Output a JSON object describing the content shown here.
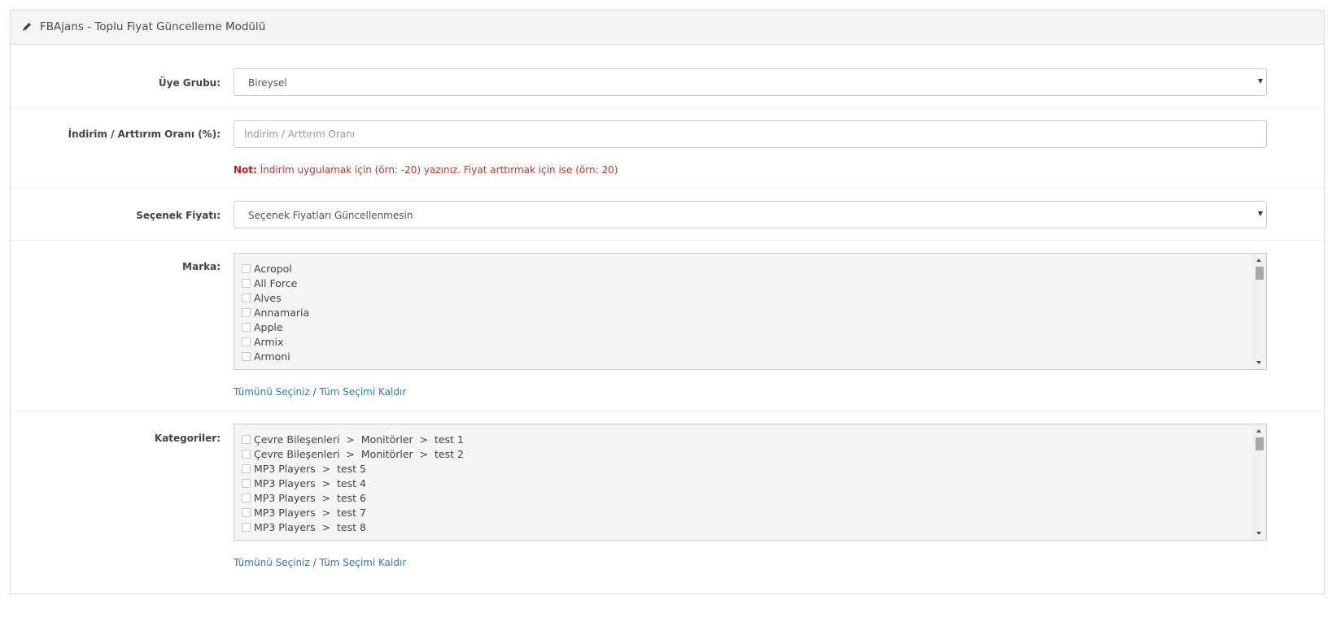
{
  "header": {
    "title": "FBAjans - Toplu Fiyat Güncelleme Modülü",
    "icon": "pencil-icon"
  },
  "form": {
    "member_group": {
      "label": "Üye Grubu:",
      "selected": "Bireysel"
    },
    "rate": {
      "label": "İndirim / Arttırım Oranı (%):",
      "placeholder": "İndirim / Arttırım Oranı",
      "value": "",
      "note_prefix": "Not:",
      "note_text": " İndirim uygulamak için (örn: -20) yazınız. Fiyat arttırmak için ise (örn: 20)"
    },
    "option_price": {
      "label": "Seçenek Fiyatı:",
      "selected": "Seçenek Fiyatları Güncellenmesin"
    },
    "brand": {
      "label": "Marka:",
      "items": [
        "Acropol",
        "All Force",
        "Alves",
        "Annamaria",
        "Apple",
        "Armix",
        "Armoni"
      ],
      "select_all": "Tümünü Seçiniz",
      "separator": " / ",
      "deselect_all": "Tüm Seçimi Kaldır"
    },
    "categories": {
      "label": "Kategoriler:",
      "items": [
        "Çevre Bileşenleri  >  Monitörler  >  test 1",
        "Çevre Bileşenleri  >  Monitörler  >  test 2",
        "MP3 Players  >  test 5",
        "MP3 Players  >  test 4",
        "MP3 Players  >  test 6",
        "MP3 Players  >  test 7",
        "MP3 Players  >  test 8"
      ],
      "select_all": "Tümünü Seçiniz",
      "separator": " / ",
      "deselect_all": "Tüm Seçimi Kaldır"
    }
  },
  "colors": {
    "note": "#c0392b",
    "link": "#2b7fb0",
    "panel_header_bg": "#f5f5f5",
    "list_bg": "#f5f5f5"
  }
}
